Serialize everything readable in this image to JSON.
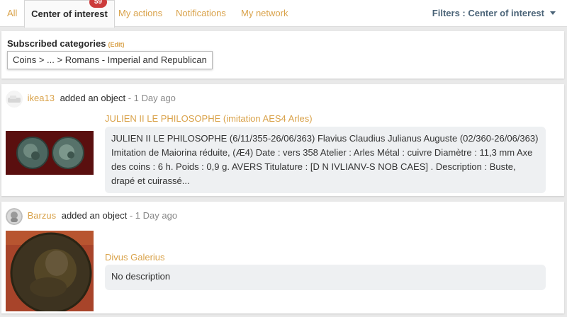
{
  "tabs": [
    {
      "label": "All"
    },
    {
      "label": "Center of interest",
      "badge": "59",
      "active": true
    },
    {
      "label": "My actions"
    },
    {
      "label": "Notifications"
    },
    {
      "label": "My network"
    }
  ],
  "filters": {
    "label": "Filters : Center of interest",
    "icon": "caret-down-icon"
  },
  "subscriptions": {
    "title": "Subscribed categories",
    "edit_label": "(Edit)",
    "category": "Coins > ... > Romans - Imperial and Republican"
  },
  "feed": [
    {
      "user": "ikea13",
      "action": "added an object",
      "time": " - 1 Day ago",
      "object_title": "JULIEN II LE PHILOSOPHE (imitation AES4 Arles)",
      "description": "JULIEN II LE PHILOSOPHE (6/11/355-26/06/363)   Flavius Claudius Julianus Auguste (02/360-26/06/363)   Imitation de Maiorina réduite, (Æ4)   Date : vers 358 Atelier : Arles Métal :  cuivre Diamètre :  11,3 mm Axe des coins :  6 h. Poids :  0,9 g.    AVERS Titulature : [D N IVLIANV-S NOB CAES] . Description : Buste, drapé et cuirassé..."
    },
    {
      "user": "Barzus",
      "action": "added an object",
      "time": " - 1 Day ago",
      "object_title": "Divus Galerius",
      "description": "No description"
    }
  ],
  "colors": {
    "accent": "#d9a24a",
    "badge": "#cc3b3b",
    "filter": "#4a6377"
  }
}
